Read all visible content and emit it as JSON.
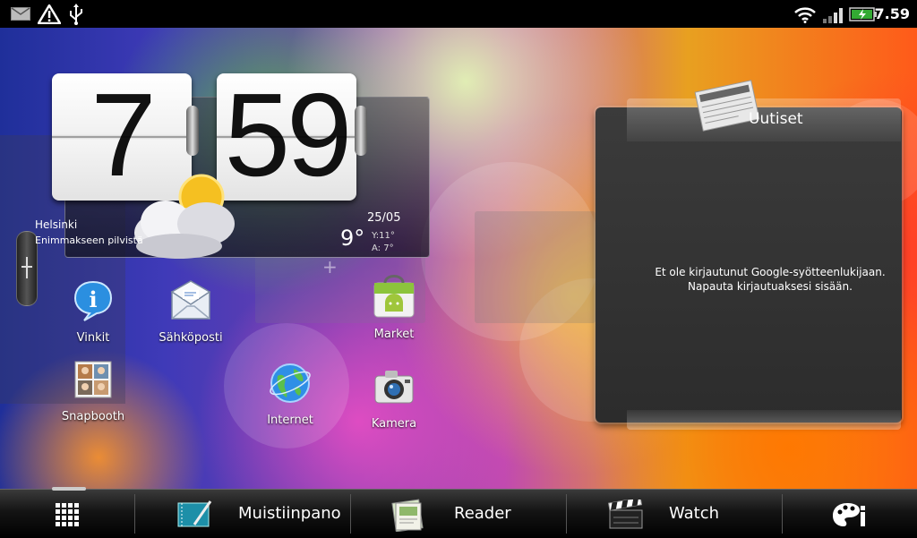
{
  "status_bar": {
    "time": "7.59",
    "left_icons": [
      "mail-icon",
      "warning-icon",
      "usb-icon"
    ],
    "right_icons": [
      "wifi-icon",
      "signal-icon",
      "battery-charging-icon"
    ]
  },
  "clock": {
    "hours": "7",
    "minutes": "59"
  },
  "weather": {
    "city": "Helsinki",
    "condition": "Enimmakseen pilvistä",
    "date": "25/05",
    "temp": "9°",
    "high": "Y:11°",
    "low": "A:  7°"
  },
  "apps": [
    {
      "label": "Vinkit",
      "icon": "tips-icon"
    },
    {
      "label": "Sähköposti",
      "icon": "mail-envelope-icon"
    },
    {
      "label": "Market",
      "icon": "market-icon"
    },
    {
      "label": "Snapbooth",
      "icon": "snapbooth-icon"
    },
    {
      "label": "Internet",
      "icon": "globe-icon"
    },
    {
      "label": "Kamera",
      "icon": "camera-icon"
    }
  ],
  "news_widget": {
    "title": "Uutiset",
    "message_line1": "Et ole kirjautunut Google-syötteenlukijaan.",
    "message_line2": "Napauta kirjautuaksesi sisään."
  },
  "dock": {
    "items": [
      {
        "label": "",
        "icon": "all-apps-grid-icon"
      },
      {
        "label": "Muistiinpano",
        "icon": "notebook-icon"
      },
      {
        "label": "Reader",
        "icon": "reader-icon"
      },
      {
        "label": "Watch",
        "icon": "clapperboard-icon"
      },
      {
        "label": "",
        "icon": "personalize-icon"
      }
    ]
  }
}
